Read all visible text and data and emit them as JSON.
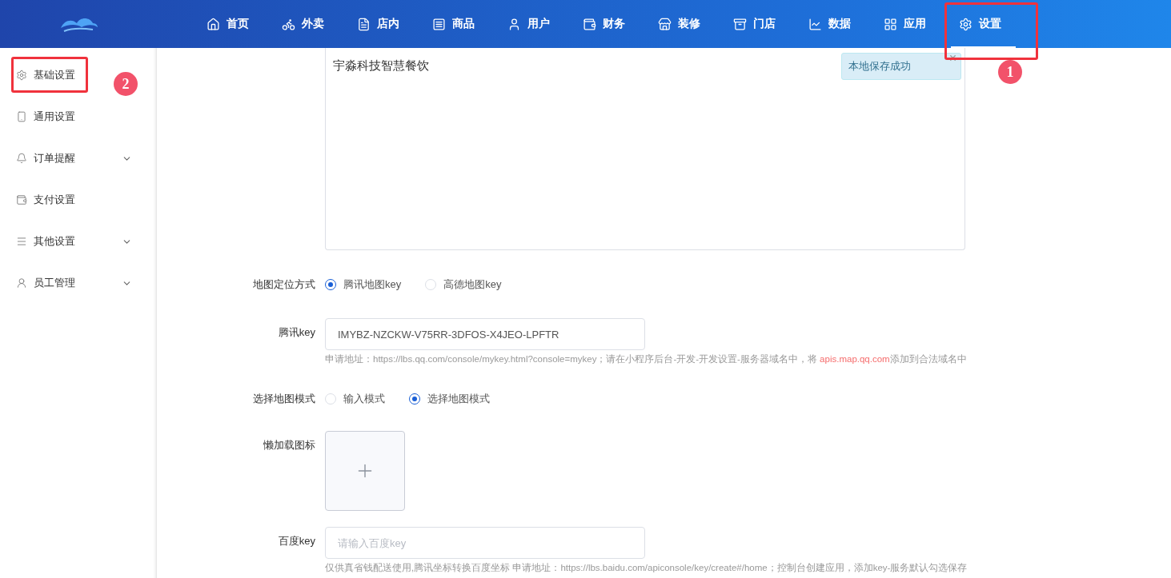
{
  "nav": [
    {
      "label": "首页",
      "selected": false
    },
    {
      "label": "外卖",
      "selected": false
    },
    {
      "label": "店内",
      "selected": false
    },
    {
      "label": "商品",
      "selected": false
    },
    {
      "label": "用户",
      "selected": false
    },
    {
      "label": "财务",
      "selected": false
    },
    {
      "label": "装修",
      "selected": false
    },
    {
      "label": "门店",
      "selected": false
    },
    {
      "label": "数据",
      "selected": false
    },
    {
      "label": "应用",
      "selected": false
    },
    {
      "label": "设置",
      "selected": true
    }
  ],
  "sidebar": {
    "items": [
      {
        "label": "基础设置",
        "expandable": false
      },
      {
        "label": "通用设置",
        "expandable": false
      },
      {
        "label": "订单提醒",
        "expandable": true
      },
      {
        "label": "支付设置",
        "expandable": false
      },
      {
        "label": "其他设置",
        "expandable": true
      },
      {
        "label": "员工管理",
        "expandable": true
      }
    ]
  },
  "form": {
    "name_value": "宇淼科技智慧餐饮",
    "toast": "本地保存成功",
    "map_mode": {
      "label": "地图定位方式",
      "options": [
        {
          "label": "腾讯地图key",
          "selected": true
        },
        {
          "label": "高德地图key",
          "selected": false
        }
      ]
    },
    "tencent_key": {
      "label": "腾讯key",
      "value": "IMYBZ-NZCKW-V75RR-3DFOS-X4JEO-LPFTR",
      "hint": {
        "before": "申请地址：https://lbs.qq.com/console/mykey.html?console=mykey；请在小程序后台-开发-开发设置-服务器域名中，将 ",
        "link": "apis.map.qq.com",
        "after": "添加到合法域名中"
      }
    },
    "select_mode": {
      "label": "选择地图模式",
      "options": [
        {
          "label": "输入模式",
          "selected": false
        },
        {
          "label": "选择地图模式",
          "selected": true
        }
      ]
    },
    "lazy_icon": {
      "label": "懒加载图标"
    },
    "baidu_key": {
      "label": "百度key",
      "placeholder": "请输入百度key",
      "hint": "仅供真省钱配送使用,腾讯坐标转换百度坐标 申请地址：https://lbs.baidu.com/apiconsole/key/create#/home；控制台创建应用，添加key-服务默认勾选保存"
    }
  },
  "annotations": [
    "1",
    "2"
  ]
}
